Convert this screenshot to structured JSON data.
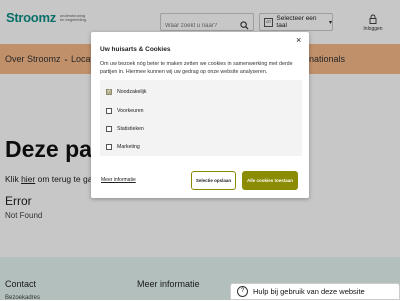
{
  "header": {
    "logo_text": "Stroomz",
    "logo_tagline": "ondersteuning en begeleiding",
    "search_placeholder": "Waar zoekt u naar?",
    "language_label": "Selecteer een taal",
    "login_label": "Inloggen"
  },
  "nav": {
    "items": [
      "Over Stroomz",
      "Locat",
      "nationals"
    ]
  },
  "page": {
    "title": "Deze pagi",
    "klik_prefix": "Klik ",
    "klik_link": "hier",
    "klik_suffix": " om terug te gaan n",
    "error_heading": "Error",
    "not_found": "Not Found"
  },
  "footer": {
    "col1_title": "Contact",
    "col1_item": "Bezoekadres",
    "col2_title": "Meer informatie",
    "help_label": "Hulp bij gebruik van deze website"
  },
  "modal": {
    "title": "Uw huisarts & Cookies",
    "text": "Om uw bezoek nóg beter te maken zetten we cookies in samenwerking met derde partijen in. Hiermee kunnen wij uw gedrag op onze website analyseren.",
    "options": [
      {
        "label": "Noodzakelijk",
        "checked": true
      },
      {
        "label": "Voorkeuren",
        "checked": false
      },
      {
        "label": "Statistieken",
        "checked": false
      },
      {
        "label": "Marketing",
        "checked": false
      }
    ],
    "more_info": "Meer informatie",
    "save_selection": "Selectie opslaan",
    "accept_all": "Alle cookies toestaan"
  },
  "colors": {
    "brand": "#0c8f86",
    "nav_bg": "#f6b98a",
    "footer_bg": "#e4f5f2",
    "accept_button": "#8c8c04"
  }
}
